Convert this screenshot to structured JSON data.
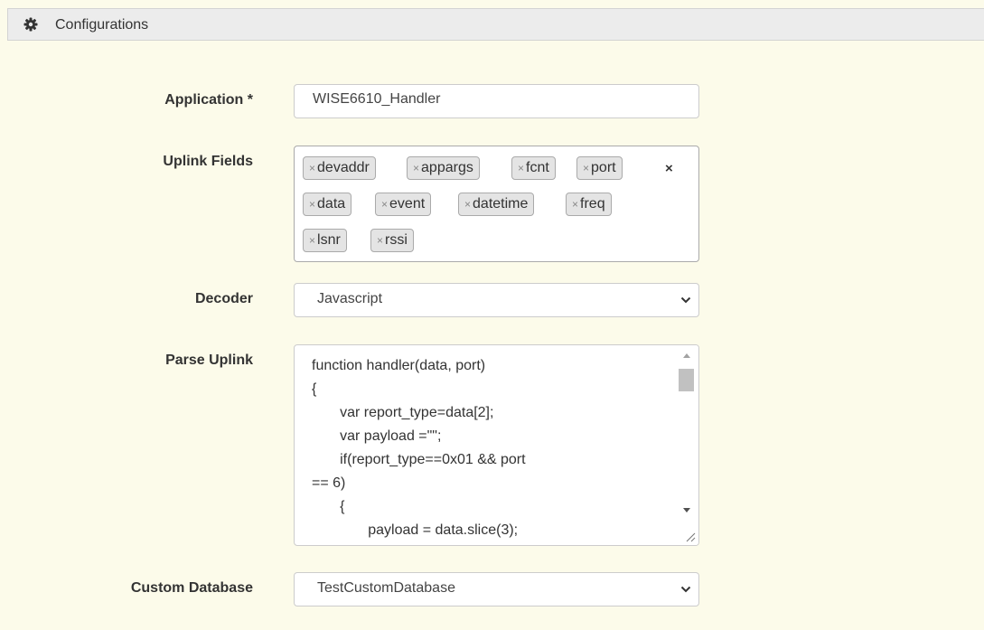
{
  "panel": {
    "title": "Configurations",
    "icon": "gear-icon"
  },
  "application": {
    "label": "Application *",
    "value": "WISE6610_Handler"
  },
  "uplink": {
    "label": "Uplink Fields",
    "tags": [
      "devaddr",
      "appargs",
      "fcnt",
      "port",
      "data",
      "event",
      "datetime",
      "freq",
      "lsnr",
      "rssi"
    ],
    "remove_glyph": "×",
    "clear_glyph": "×"
  },
  "decoder": {
    "label": "Decoder",
    "value": "Javascript"
  },
  "parse": {
    "label": "Parse Uplink",
    "code": "function handler(data, port)\n{\n       var report_type=data[2];\n       var payload =\"\";\n       if(report_type==0x01 && port\n== 6)\n       {\n              payload = data.slice(3);"
  },
  "database": {
    "label": "Custom Database",
    "value": "TestCustomDatabase"
  }
}
